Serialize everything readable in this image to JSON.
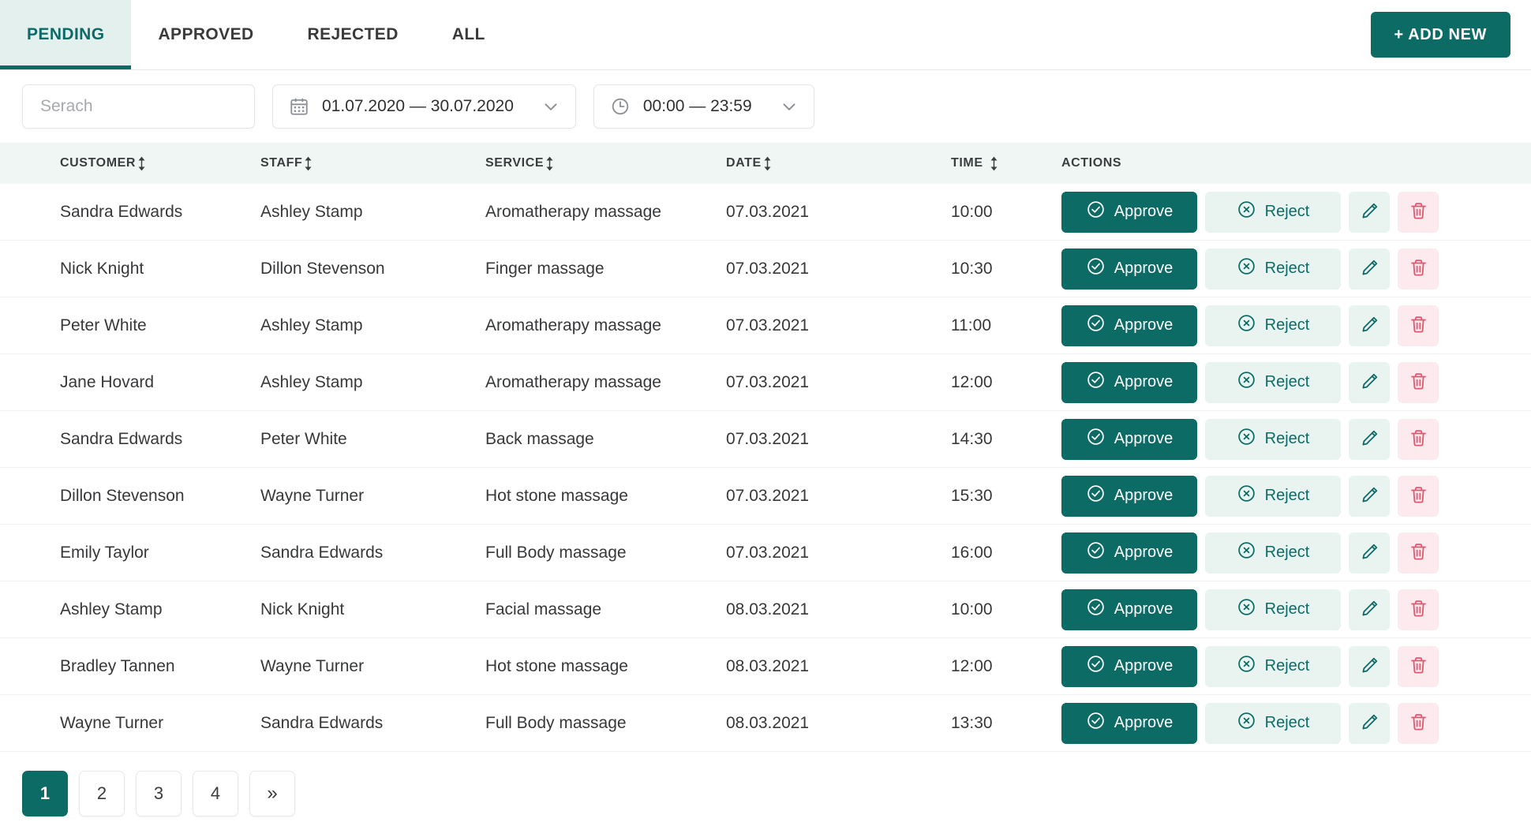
{
  "theme": {
    "accent": "#0d6b66",
    "accent_soft": "#e9f4f1",
    "tab_active_bg": "#e4f0ee",
    "header_bg": "#eff6f4",
    "danger_soft": "#fdeaee",
    "danger": "#e4566e"
  },
  "tabs": [
    {
      "label": "PENDING",
      "active": true
    },
    {
      "label": "APPROVED",
      "active": false
    },
    {
      "label": "REJECTED",
      "active": false
    },
    {
      "label": "ALL",
      "active": false
    }
  ],
  "toolbar": {
    "add_new_label": "+ ADD NEW"
  },
  "filters": {
    "search": {
      "value": "",
      "placeholder": "Serach",
      "icon": "search-icon"
    },
    "date_range": {
      "value": "01.07.2020 — 30.07.2020",
      "icon": "calendar-icon",
      "chevron": "chevron-down-icon"
    },
    "time_range": {
      "value": "00:00 — 23:59",
      "icon": "clock-icon",
      "chevron": "chevron-down-icon"
    }
  },
  "table": {
    "columns": [
      {
        "label": "CUSTOMER",
        "sortable": true
      },
      {
        "label": "STAFF",
        "sortable": true
      },
      {
        "label": "SERVICE",
        "sortable": true
      },
      {
        "label": "DATE",
        "sortable": true
      },
      {
        "label": "TIME",
        "sortable": true
      },
      {
        "label": "ACTIONS",
        "sortable": false
      }
    ],
    "row_actions": {
      "approve_label": "Approve",
      "reject_label": "Reject",
      "approve_icon": "check-circle-icon",
      "reject_icon": "x-circle-icon",
      "edit_icon": "pencil-icon",
      "delete_icon": "trash-icon"
    },
    "rows": [
      {
        "customer": "Sandra Edwards",
        "staff": "Ashley Stamp",
        "service": "Aromatherapy massage",
        "date": "07.03.2021",
        "time": "10:00"
      },
      {
        "customer": "Nick Knight",
        "staff": "Dillon Stevenson",
        "service": "Finger massage",
        "date": "07.03.2021",
        "time": "10:30"
      },
      {
        "customer": "Peter White",
        "staff": "Ashley Stamp",
        "service": "Aromatherapy massage",
        "date": "07.03.2021",
        "time": "11:00"
      },
      {
        "customer": "Jane Hovard",
        "staff": "Ashley Stamp",
        "service": "Aromatherapy massage",
        "date": "07.03.2021",
        "time": "12:00"
      },
      {
        "customer": "Sandra Edwards",
        "staff": "Peter White",
        "service": "Back massage",
        "date": "07.03.2021",
        "time": "14:30"
      },
      {
        "customer": "Dillon Stevenson",
        "staff": "Wayne Turner",
        "service": "Hot stone massage",
        "date": "07.03.2021",
        "time": "15:30"
      },
      {
        "customer": "Emily Taylor",
        "staff": "Sandra Edwards",
        "service": "Full Body massage",
        "date": "07.03.2021",
        "time": "16:00"
      },
      {
        "customer": "Ashley Stamp",
        "staff": "Nick Knight",
        "service": "Facial massage",
        "date": "08.03.2021",
        "time": "10:00"
      },
      {
        "customer": "Bradley Tannen",
        "staff": "Wayne Turner",
        "service": "Hot stone massage",
        "date": "08.03.2021",
        "time": "12:00"
      },
      {
        "customer": "Wayne Turner",
        "staff": "Sandra Edwards",
        "service": "Full Body massage",
        "date": "08.03.2021",
        "time": "13:30"
      }
    ]
  },
  "pagination": {
    "pages": [
      "1",
      "2",
      "3",
      "4"
    ],
    "active_page": "1",
    "next_label": "»"
  }
}
